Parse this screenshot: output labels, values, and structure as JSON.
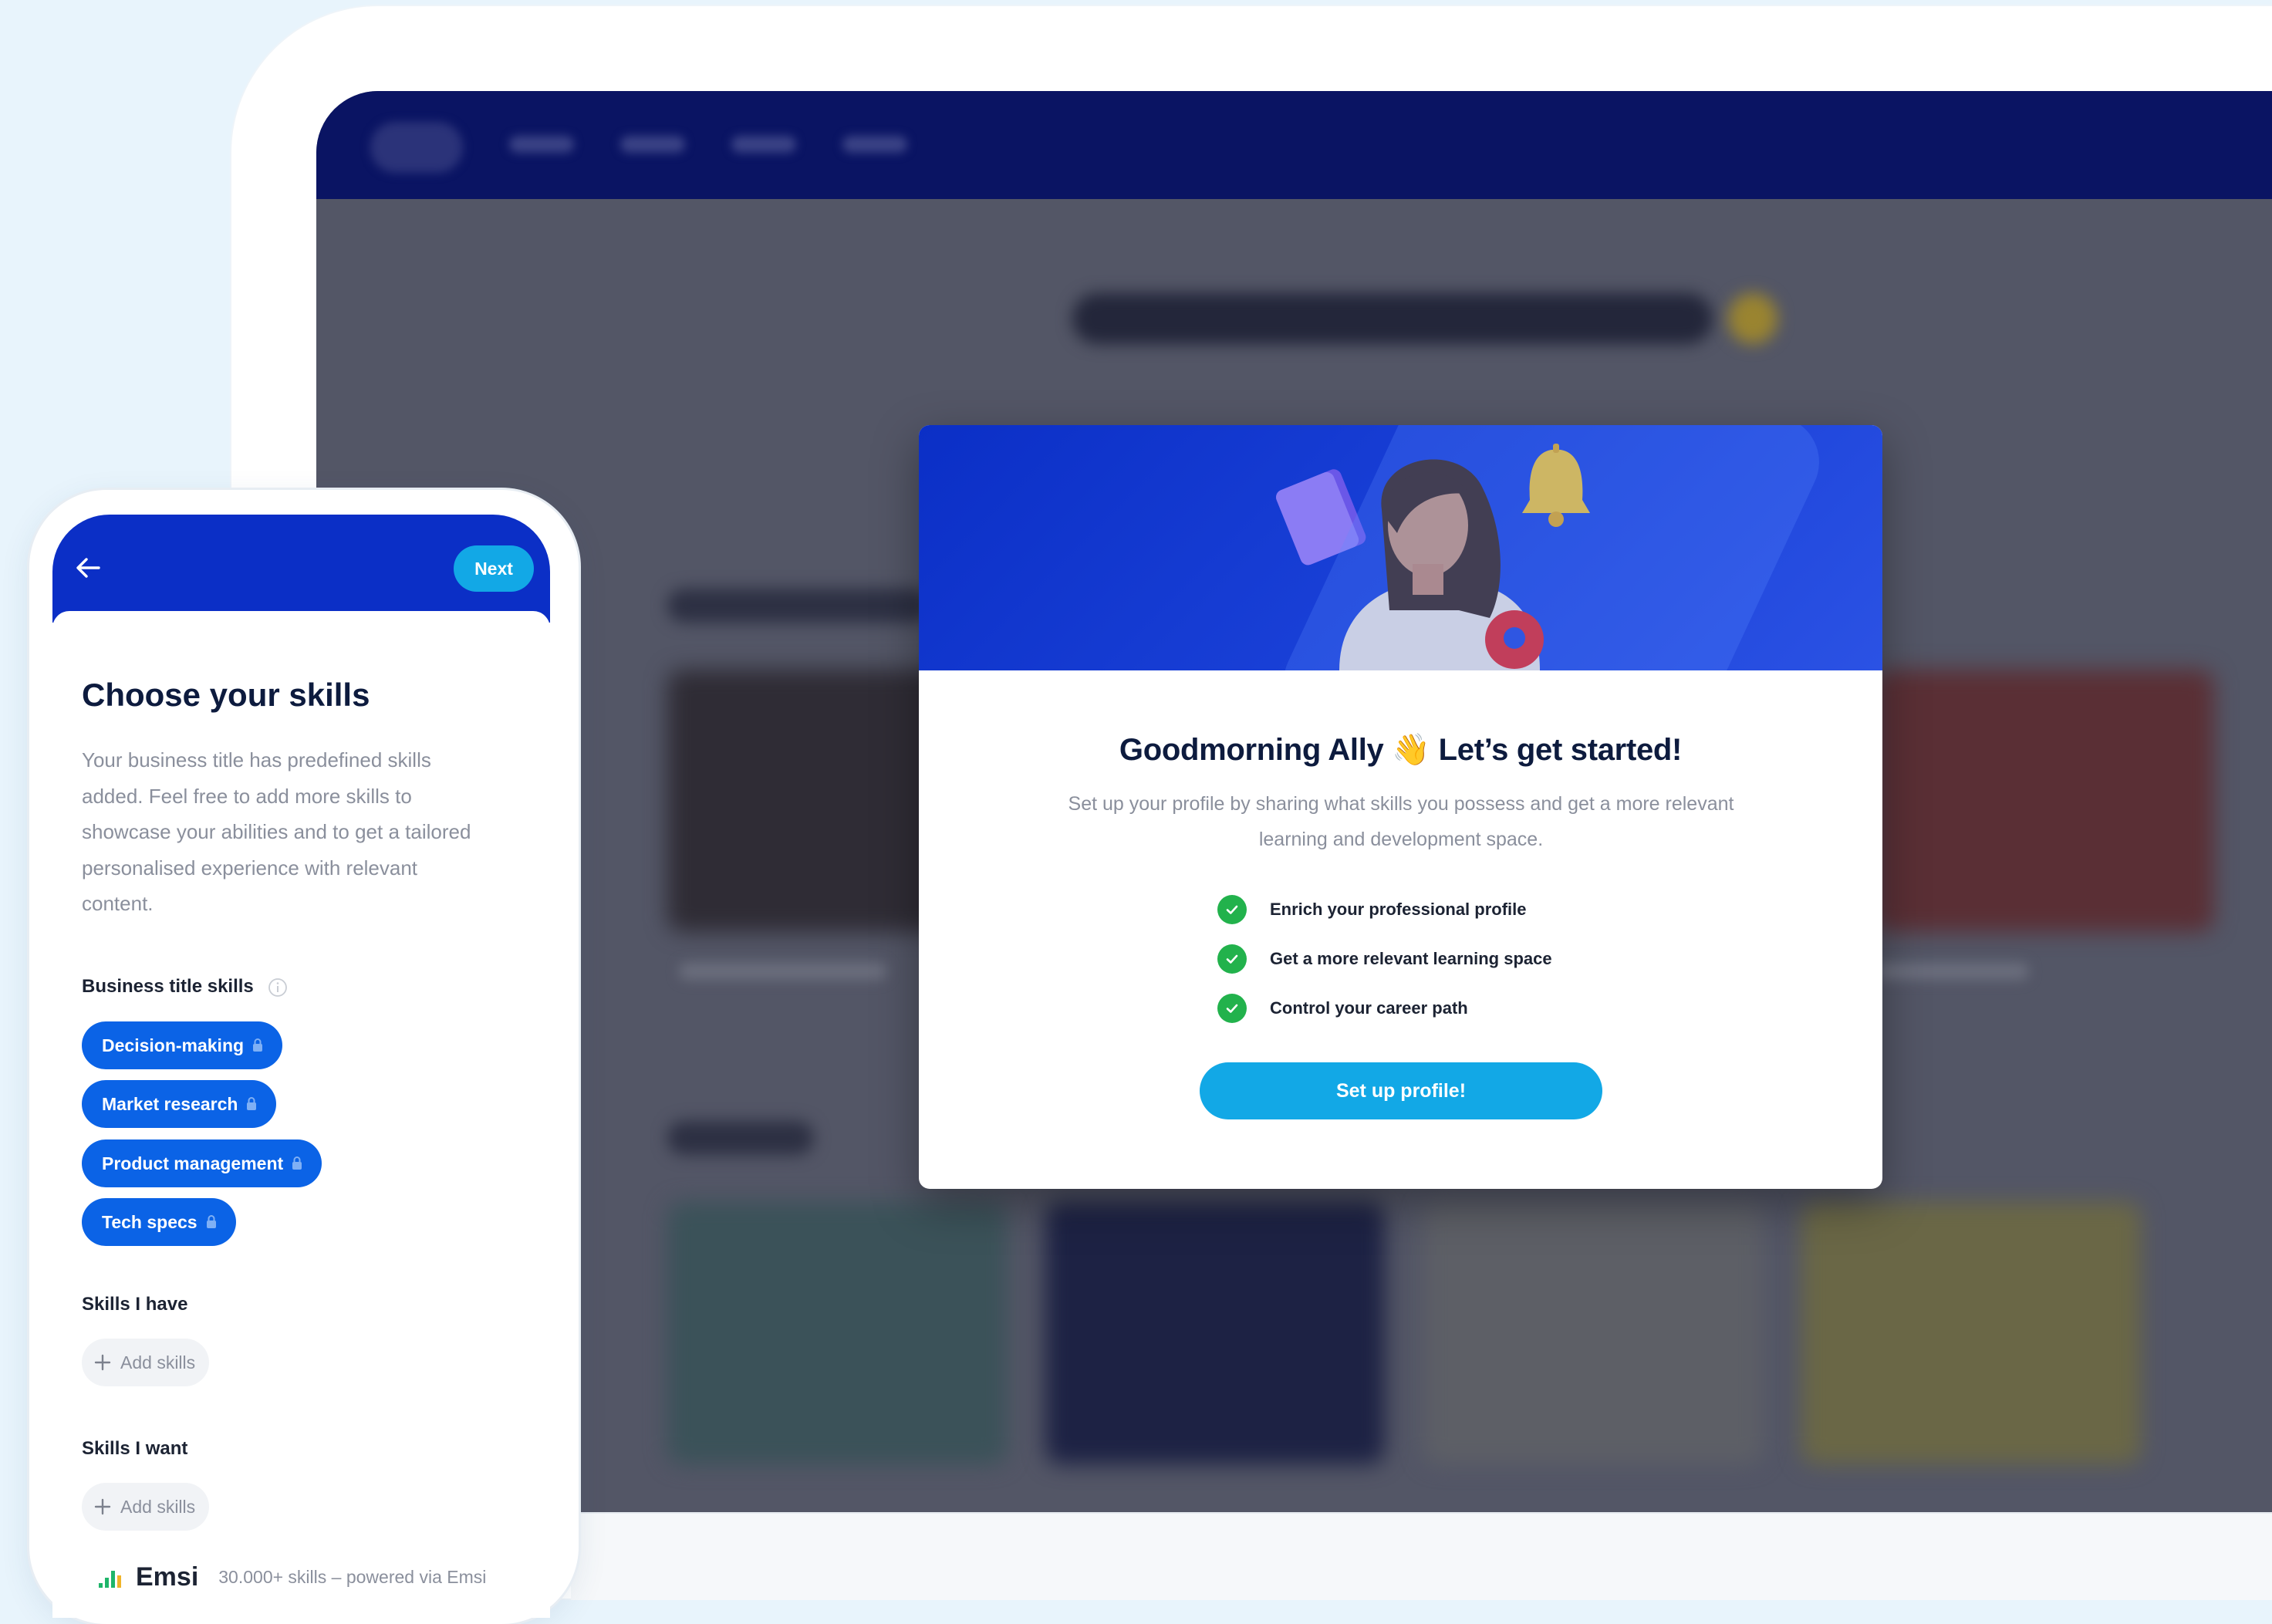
{
  "modal": {
    "greeting": "Goodmorning Ally",
    "wave_emoji": "👋",
    "tagline": "Let’s get started!",
    "description_line1": "Set up your profile by sharing what skills you possess and get a more relevant",
    "description_line2": "learning and development space.",
    "benefits": [
      "Enrich your professional profile",
      "Get a more relevant learning space",
      "Control your career path"
    ],
    "cta_label": "Set up profile!",
    "colors": {
      "hero": "#0b2fc6",
      "cta": "#12a8e6",
      "check": "#22b24c"
    }
  },
  "phone": {
    "next_label": "Next",
    "title": "Choose your skills",
    "description_lines": [
      "Your business title has predefined skills",
      "added. Feel free to add more skills to",
      "showcase your abilities and to get a tailored",
      "personalised experience with relevant",
      "content."
    ],
    "business_title_skills_label": "Business title skills",
    "business_title_skills": [
      "Decision-making",
      "Market research",
      "Product management",
      "Tech specs"
    ],
    "skills_have_label": "Skills I have",
    "skills_want_label": "Skills I want",
    "add_skills_label": "Add skills",
    "footer_brand": "Emsi",
    "footer_note": "30.000+ skills – powered via Emsi",
    "colors": {
      "chip": "#0b63e6",
      "header": "#0b2fc6"
    }
  }
}
